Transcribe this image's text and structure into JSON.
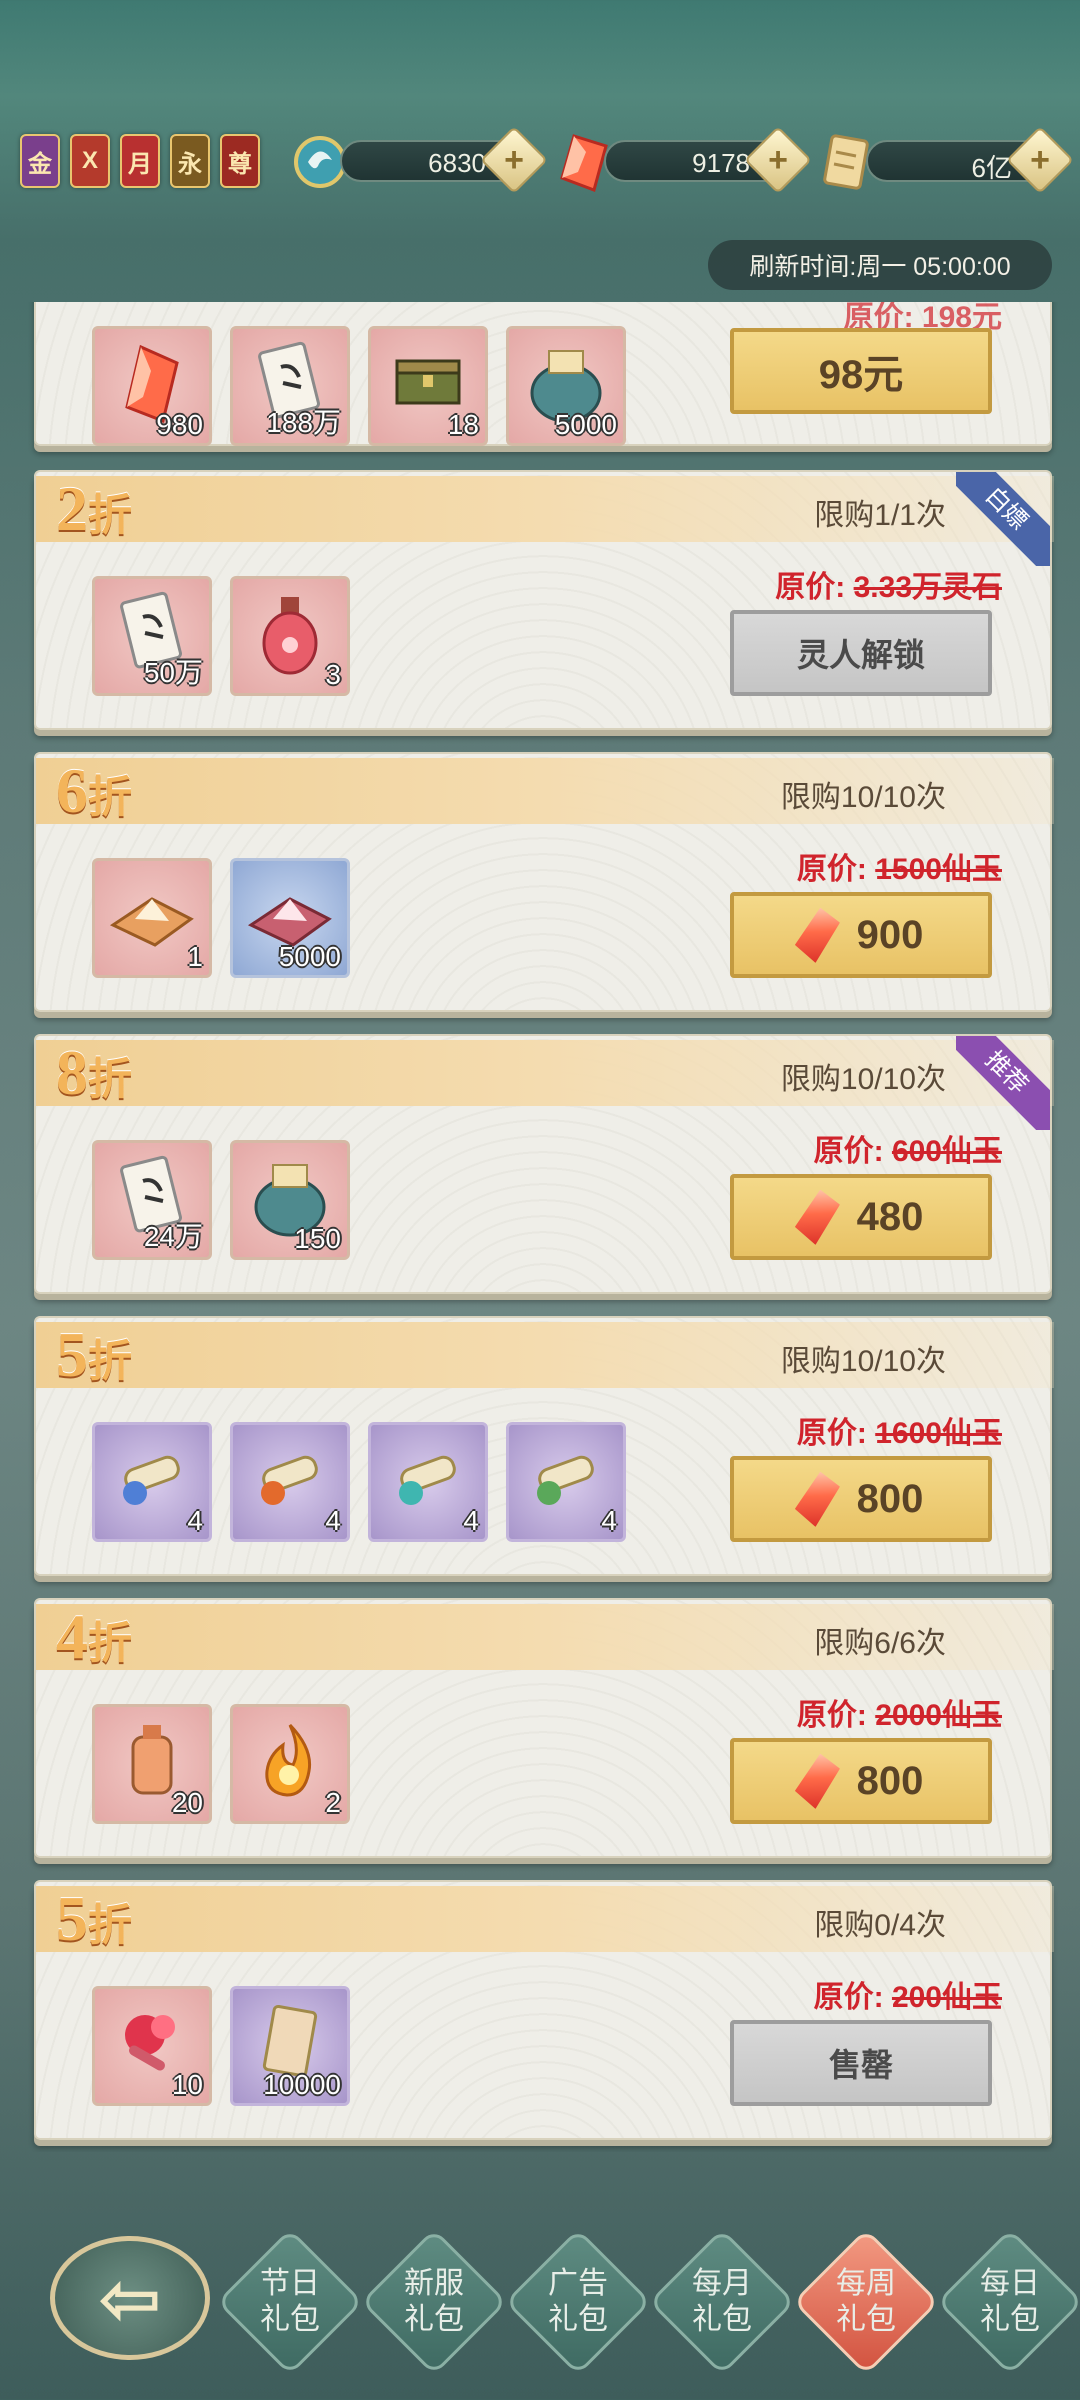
{
  "currency_badges": [
    "金",
    "X",
    "月",
    "永",
    "尊"
  ],
  "resources": [
    {
      "icon": "lingshi-swirl-icon",
      "value": "6830"
    },
    {
      "icon": "xianyu-gem-icon",
      "value": "9178"
    },
    {
      "icon": "scroll-icon",
      "value": "6亿"
    }
  ],
  "refresh_text": "刷新时间:周一 05:00:00",
  "cards": [
    {
      "partial_price": "原价: 198元",
      "items": [
        {
          "icon": "gem-icon",
          "qty": "980",
          "bg": "pink"
        },
        {
          "icon": "scroll-icon",
          "qty": "188万",
          "bg": "pink"
        },
        {
          "icon": "chest-icon",
          "qty": "18",
          "bg": "pink"
        },
        {
          "icon": "bag-icon",
          "qty": "5000",
          "bg": "pink"
        }
      ],
      "button": "98元",
      "button_style": "gold"
    },
    {
      "discount_num": "2",
      "discount_unit": "折",
      "limit": "限购1/1次",
      "corner": "白嫖",
      "corner_color": "#4a65a8",
      "orig_label": "原价:",
      "orig_value": "3.33万灵石",
      "items": [
        {
          "icon": "scroll-icon",
          "qty": "50万",
          "bg": "pink"
        },
        {
          "icon": "potion-icon",
          "qty": "3",
          "bg": "pink"
        }
      ],
      "button": "灵人解锁",
      "button_style": "gray"
    },
    {
      "discount_num": "6",
      "discount_unit": "折",
      "limit": "限购10/10次",
      "orig_label": "原价:",
      "orig_value": "1500仙玉",
      "items": [
        {
          "icon": "powder-icon",
          "qty": "1",
          "bg": "pink"
        },
        {
          "icon": "powder-icon",
          "qty": "5000",
          "bg": "blue"
        }
      ],
      "button": "900",
      "button_style": "gold"
    },
    {
      "discount_num": "8",
      "discount_unit": "折",
      "limit": "限购10/10次",
      "corner": "推荐",
      "corner_color": "#8b4fb0",
      "orig_label": "原价:",
      "orig_value": "600仙玉",
      "items": [
        {
          "icon": "scroll-icon",
          "qty": "24万",
          "bg": "pink"
        },
        {
          "icon": "bag-icon",
          "qty": "150",
          "bg": "pink"
        }
      ],
      "button": "480",
      "button_style": "gold"
    },
    {
      "discount_num": "5",
      "discount_unit": "折",
      "limit": "限购10/10次",
      "orig_label": "原价:",
      "orig_value": "1600仙玉",
      "items": [
        {
          "icon": "blue-scroll-icon",
          "qty": "4",
          "bg": "purple"
        },
        {
          "icon": "orange-scroll-icon",
          "qty": "4",
          "bg": "purple"
        },
        {
          "icon": "teal-scroll-icon",
          "qty": "4",
          "bg": "purple"
        },
        {
          "icon": "green-scroll-icon",
          "qty": "4",
          "bg": "purple"
        }
      ],
      "button": "800",
      "button_style": "gold"
    },
    {
      "discount_num": "4",
      "discount_unit": "折",
      "limit": "限购6/6次",
      "orig_label": "原价:",
      "orig_value": "2000仙玉",
      "items": [
        {
          "icon": "bottle-icon",
          "qty": "20",
          "bg": "pink"
        },
        {
          "icon": "fire-icon",
          "qty": "2",
          "bg": "pink"
        }
      ],
      "button": "800",
      "button_style": "gold"
    },
    {
      "discount_num": "5",
      "discount_unit": "折",
      "limit": "限购0/4次",
      "orig_label": "原价:",
      "orig_value": "200仙玉",
      "items": [
        {
          "icon": "flower-icon",
          "qty": "10",
          "bg": "pink"
        },
        {
          "icon": "card-icon",
          "qty": "10000",
          "bg": "purple"
        }
      ],
      "button": "售罄",
      "button_style": "gray"
    }
  ],
  "tabs": [
    {
      "line1": "节日",
      "line2": "礼包",
      "active": false
    },
    {
      "line1": "新服",
      "line2": "礼包",
      "active": false
    },
    {
      "line1": "广告",
      "line2": "礼包",
      "active": false
    },
    {
      "line1": "每月",
      "line2": "礼包",
      "active": false
    },
    {
      "line1": "每周",
      "line2": "礼包",
      "active": true
    },
    {
      "line1": "每日",
      "line2": "礼包",
      "active": false
    }
  ]
}
